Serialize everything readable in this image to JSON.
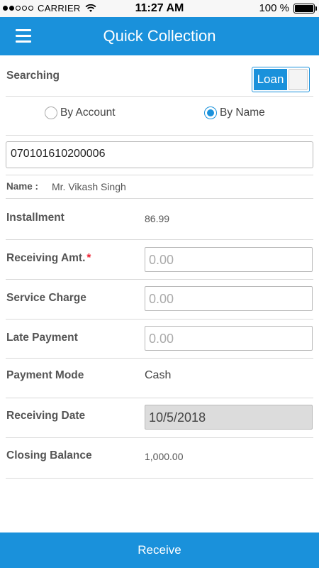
{
  "status_bar": {
    "carrier": "CARRIER",
    "time": "11:27 AM",
    "battery": "100 %",
    "battery_level": 1.0,
    "wifi_icon": "wifi-icon"
  },
  "header": {
    "title": "Quick Collection",
    "menu_icon": "hamburger-menu-icon",
    "color": "#1a91db"
  },
  "search": {
    "label": "Searching",
    "toggle_label": "Loan",
    "options": [
      "By Account",
      "By Name"
    ],
    "selected": "By Name"
  },
  "account": {
    "number": "070101610200006"
  },
  "customer": {
    "name_label": "Name :",
    "name_value": "Mr. Vikash Singh"
  },
  "form": {
    "installment_label": "Installment",
    "installment_value": "86.99",
    "receiving_amt_label": "Receiving Amt.",
    "required_mark": "*",
    "receiving_amt_placeholder": "0.00",
    "service_charge_label": "Service Charge",
    "service_charge_placeholder": "0.00",
    "late_payment_label": "Late Payment",
    "late_payment_placeholder": "0.00",
    "payment_mode_label": "Payment Mode",
    "payment_mode_value": "Cash",
    "receiving_date_label": "Receiving Date",
    "receiving_date_value": "10/5/2018",
    "closing_balance_label": "Closing Balance",
    "closing_balance_value": "1,000.00"
  },
  "footer": {
    "receive_label": "Receive"
  }
}
